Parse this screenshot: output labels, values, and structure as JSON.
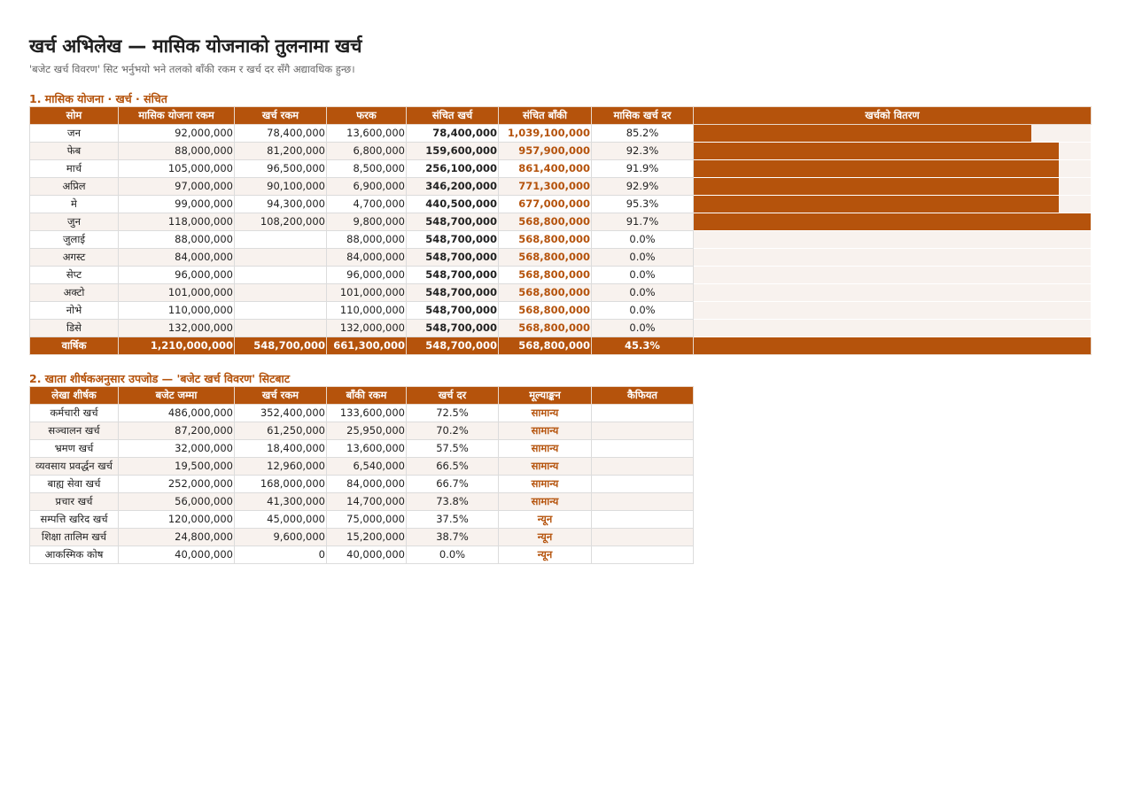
{
  "page": {
    "title": "खर्च अभिलेख — मासिक योजनाको तुलनामा खर्च",
    "subtitle": "'बजेट खर्च विवरण' सिट भर्नुभयो भने तलको बाँकी रकम र खर्च दर सँगै अद्यावधिक हुन्छ।"
  },
  "colors": {
    "accent": "#b5530c",
    "band": "#f8f2ee"
  },
  "monthly": {
    "section_title": "1. मासिक योजना · खर्च · संचित",
    "headers": [
      "सोम",
      "मासिक योजना रकम",
      "खर्च रकम",
      "फरक",
      "संचित खर्च",
      "संचित बाँकी",
      "मासिक खर्च दर",
      "खर्चको वितरण"
    ],
    "rows": [
      {
        "month": "जन",
        "plan": "92,000,000",
        "spent": "78,400,000",
        "diff": "13,600,000",
        "cum_spent": "78,400,000",
        "cum_left": "1,039,100,000",
        "rate": "85.2%",
        "bar": 0.85
      },
      {
        "month": "फेब",
        "plan": "88,000,000",
        "spent": "81,200,000",
        "diff": "6,800,000",
        "cum_spent": "159,600,000",
        "cum_left": "957,900,000",
        "rate": "92.3%",
        "bar": 0.92
      },
      {
        "month": "मार्च",
        "plan": "105,000,000",
        "spent": "96,500,000",
        "diff": "8,500,000",
        "cum_spent": "256,100,000",
        "cum_left": "861,400,000",
        "rate": "91.9%",
        "bar": 0.92
      },
      {
        "month": "अप्रिल",
        "plan": "97,000,000",
        "spent": "90,100,000",
        "diff": "6,900,000",
        "cum_spent": "346,200,000",
        "cum_left": "771,300,000",
        "rate": "92.9%",
        "bar": 0.92
      },
      {
        "month": "मे",
        "plan": "99,000,000",
        "spent": "94,300,000",
        "diff": "4,700,000",
        "cum_spent": "440,500,000",
        "cum_left": "677,000,000",
        "rate": "95.3%",
        "bar": 0.92
      },
      {
        "month": "जुन",
        "plan": "118,000,000",
        "spent": "108,200,000",
        "diff": "9,800,000",
        "cum_spent": "548,700,000",
        "cum_left": "568,800,000",
        "rate": "91.7%",
        "bar": 1.0
      },
      {
        "month": "जुलाई",
        "plan": "88,000,000",
        "spent": "",
        "diff": "88,000,000",
        "cum_spent": "548,700,000",
        "cum_left": "568,800,000",
        "rate": "0.0%",
        "bar": 0
      },
      {
        "month": "अगस्ट",
        "plan": "84,000,000",
        "spent": "",
        "diff": "84,000,000",
        "cum_spent": "548,700,000",
        "cum_left": "568,800,000",
        "rate": "0.0%",
        "bar": 0
      },
      {
        "month": "सेप्ट",
        "plan": "96,000,000",
        "spent": "",
        "diff": "96,000,000",
        "cum_spent": "548,700,000",
        "cum_left": "568,800,000",
        "rate": "0.0%",
        "bar": 0
      },
      {
        "month": "अक्टो",
        "plan": "101,000,000",
        "spent": "",
        "diff": "101,000,000",
        "cum_spent": "548,700,000",
        "cum_left": "568,800,000",
        "rate": "0.0%",
        "bar": 0
      },
      {
        "month": "नोभे",
        "plan": "110,000,000",
        "spent": "",
        "diff": "110,000,000",
        "cum_spent": "548,700,000",
        "cum_left": "568,800,000",
        "rate": "0.0%",
        "bar": 0
      },
      {
        "month": "डिसे",
        "plan": "132,000,000",
        "spent": "",
        "diff": "132,000,000",
        "cum_spent": "548,700,000",
        "cum_left": "568,800,000",
        "rate": "0.0%",
        "bar": 0
      }
    ],
    "total": {
      "month": "वार्षिक",
      "plan": "1,210,000,000",
      "spent": "548,700,000",
      "diff": "661,300,000",
      "cum_spent": "548,700,000",
      "cum_left": "568,800,000",
      "rate": "45.3%",
      "bar": 1.0
    }
  },
  "accounts": {
    "section_title": "2. खाता शीर्षकअनुसार उपजोड — 'बजेट खर्च विवरण' सिटबाट",
    "headers": [
      "लेखा शीर्षक",
      "बजेट जम्मा",
      "खर्च रकम",
      "बाँकी रकम",
      "खर्च दर",
      "मूल्याङ्कन",
      "कैफियत"
    ],
    "rows": [
      {
        "name": "कर्मचारी खर्च",
        "budget": "486,000,000",
        "spent": "352,400,000",
        "left": "133,600,000",
        "rate": "72.5%",
        "eval": "सामान्य",
        "note": ""
      },
      {
        "name": "सञ्चालन खर्च",
        "budget": "87,200,000",
        "spent": "61,250,000",
        "left": "25,950,000",
        "rate": "70.2%",
        "eval": "सामान्य",
        "note": ""
      },
      {
        "name": "भ्रमण खर्च",
        "budget": "32,000,000",
        "spent": "18,400,000",
        "left": "13,600,000",
        "rate": "57.5%",
        "eval": "सामान्य",
        "note": ""
      },
      {
        "name": "व्यवसाय प्रवर्द्धन खर्च",
        "budget": "19,500,000",
        "spent": "12,960,000",
        "left": "6,540,000",
        "rate": "66.5%",
        "eval": "सामान्य",
        "note": ""
      },
      {
        "name": "बाह्य सेवा खर्च",
        "budget": "252,000,000",
        "spent": "168,000,000",
        "left": "84,000,000",
        "rate": "66.7%",
        "eval": "सामान्य",
        "note": ""
      },
      {
        "name": "प्रचार खर्च",
        "budget": "56,000,000",
        "spent": "41,300,000",
        "left": "14,700,000",
        "rate": "73.8%",
        "eval": "सामान्य",
        "note": ""
      },
      {
        "name": "सम्पत्ति खरिद खर्च",
        "budget": "120,000,000",
        "spent": "45,000,000",
        "left": "75,000,000",
        "rate": "37.5%",
        "eval": "न्यून",
        "note": ""
      },
      {
        "name": "शिक्षा तालिम खर्च",
        "budget": "24,800,000",
        "spent": "9,600,000",
        "left": "15,200,000",
        "rate": "38.7%",
        "eval": "न्यून",
        "note": ""
      },
      {
        "name": "आकस्मिक कोष",
        "budget": "40,000,000",
        "spent": "0",
        "left": "40,000,000",
        "rate": "0.0%",
        "eval": "न्यून",
        "note": ""
      }
    ]
  }
}
